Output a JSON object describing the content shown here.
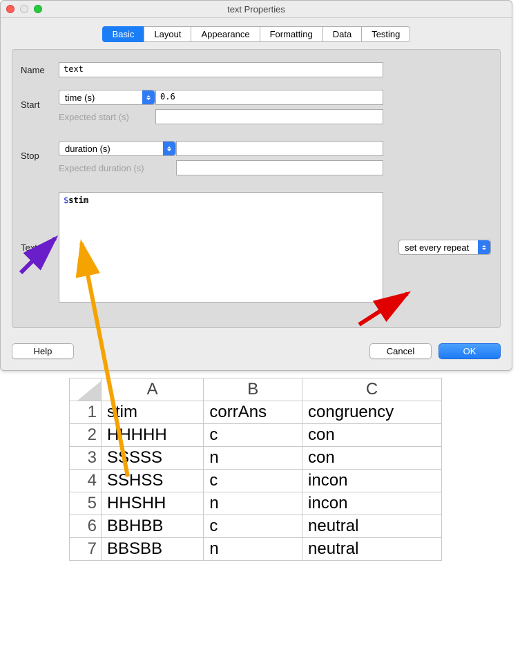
{
  "dialog": {
    "title": "text Properties",
    "tabs": [
      "Basic",
      "Layout",
      "Appearance",
      "Formatting",
      "Data",
      "Testing"
    ],
    "active_tab": 0,
    "name": {
      "label": "Name",
      "value": "text"
    },
    "start": {
      "label": "Start",
      "mode": "time (s)",
      "value": "0.6",
      "expected_label": "Expected start (s)",
      "expected_value": ""
    },
    "stop": {
      "label": "Stop",
      "mode": "duration (s)",
      "value": "",
      "expected_label": "Expected duration (s)",
      "expected_value": ""
    },
    "text": {
      "label": "Text",
      "value": "$stim",
      "update": "set every repeat"
    },
    "buttons": {
      "help": "Help",
      "cancel": "Cancel",
      "ok": "OK"
    }
  },
  "sheet": {
    "cols": [
      "A",
      "B",
      "C"
    ],
    "headers": [
      "stim",
      "corrAns",
      "congruency"
    ],
    "rows": [
      [
        "HHHHH",
        "c",
        "con"
      ],
      [
        "SSSSS",
        "n",
        "con"
      ],
      [
        "SSHSS",
        "c",
        "incon"
      ],
      [
        "HHSHH",
        "n",
        "incon"
      ],
      [
        "BBHBB",
        "c",
        "neutral"
      ],
      [
        "BBSBB",
        "n",
        "neutral"
      ]
    ]
  },
  "annotations": {
    "purple_arrow": "points to $stim text",
    "red_arrow": "points to set every repeat",
    "orange_arrow": "links $stim to stim column header"
  }
}
